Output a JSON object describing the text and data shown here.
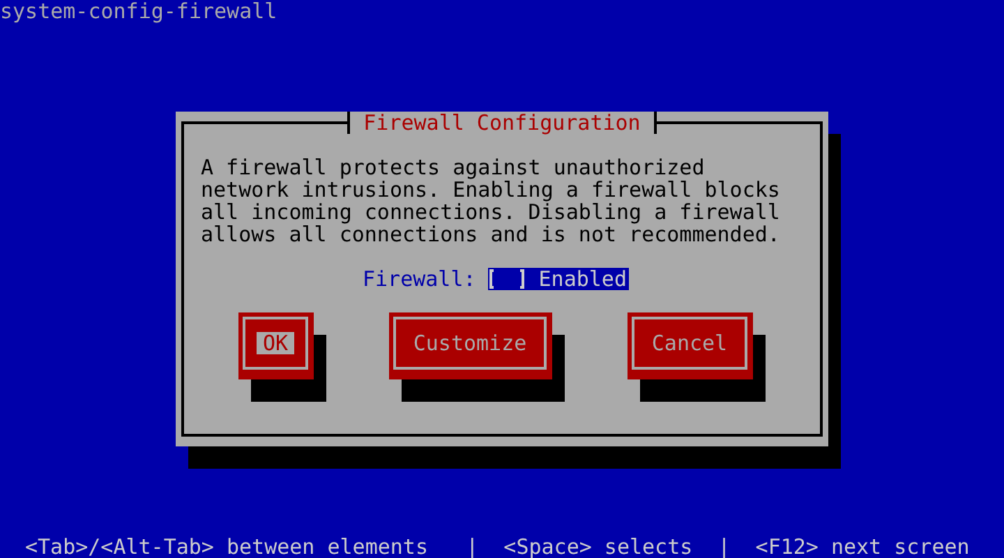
{
  "screen_title": "system-config-firewall",
  "dialog": {
    "title": "Firewall Configuration",
    "message": "A firewall protects against unauthorized network intrusions. Enabling a firewall blocks all incoming connections. Disabling a firewall allows all connections and is not recommended.",
    "field_label": "Firewall:",
    "checkbox": {
      "label": "Enabled",
      "checked": false
    },
    "buttons": [
      {
        "label": "OK",
        "selected": true
      },
      {
        "label": "Customize",
        "selected": false
      },
      {
        "label": "Cancel",
        "selected": false
      }
    ]
  },
  "help_line": "<Tab>/<Alt-Tab> between elements   |  <Space> selects  |  <F12> next screen"
}
